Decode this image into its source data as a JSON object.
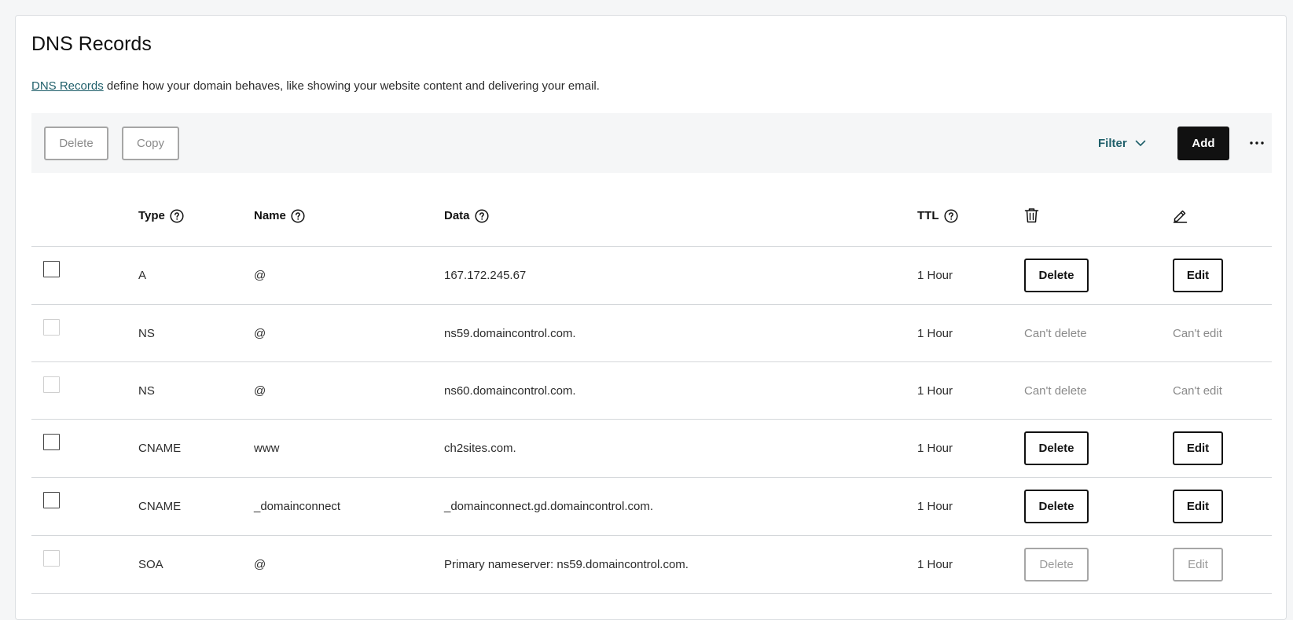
{
  "page": {
    "title": "DNS Records",
    "description_link": "DNS Records",
    "description_text": " define how your domain behaves, like showing your website content and delivering your email."
  },
  "toolbar": {
    "delete_label": "Delete",
    "copy_label": "Copy",
    "filter_label": "Filter",
    "add_label": "Add",
    "more_label": "···"
  },
  "table": {
    "headers": {
      "type": "Type",
      "name": "Name",
      "data": "Data",
      "ttl": "TTL"
    },
    "rows": [
      {
        "type": "A",
        "name": "@",
        "data": "167.172.245.67",
        "ttl": "1 Hour",
        "delete": "Delete",
        "edit": "Edit"
      },
      {
        "type": "NS",
        "name": "@",
        "data": "ns59.domaincontrol.com.",
        "ttl": "1 Hour",
        "delete": "Can't delete",
        "edit": "Can't edit"
      },
      {
        "type": "NS",
        "name": "@",
        "data": "ns60.domaincontrol.com.",
        "ttl": "1 Hour",
        "delete": "Can't delete",
        "edit": "Can't edit"
      },
      {
        "type": "CNAME",
        "name": "www",
        "data": "ch2sites.com.",
        "ttl": "1 Hour",
        "delete": "Delete",
        "edit": "Edit"
      },
      {
        "type": "CNAME",
        "name": "_domainconnect",
        "data": "_domainconnect.gd.domaincontrol.com.",
        "ttl": "1 Hour",
        "delete": "Delete",
        "edit": "Edit"
      },
      {
        "type": "SOA",
        "name": "@",
        "data": "Primary nameserver: ns59.domaincontrol.com.",
        "ttl": "1 Hour",
        "delete": "Delete",
        "edit": "Edit"
      }
    ]
  },
  "colors": {
    "link": "#1f5f6a",
    "primary_button": "#111111",
    "toolbar_bg": "#f5f6f7",
    "disabled": "#a6a6a6"
  },
  "icons": {
    "help": "question-circle-icon",
    "delete_column": "trash-icon",
    "edit_column": "pencil-icon",
    "filter": "chevron-down-icon",
    "more": "more-horizontal-icon"
  }
}
